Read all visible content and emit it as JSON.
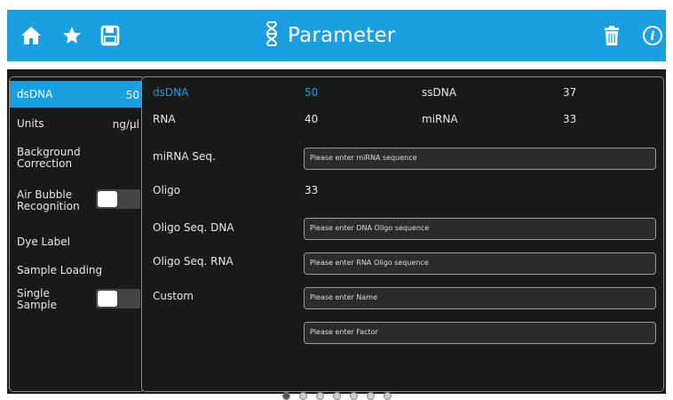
{
  "header": {
    "title": "Parameter",
    "icons": [
      "home-icon",
      "star-icon",
      "save-icon",
      "dna-icon",
      "trash-icon",
      "info-icon"
    ],
    "background_color": "#1aa0e0"
  },
  "sidebar": {
    "items": [
      {
        "label": "dsDNA",
        "value": "50",
        "selected": true
      },
      {
        "label": "Units",
        "value": "ng/µl"
      },
      {
        "label": "Background Correction"
      },
      {
        "label": "Air Bubble Recognition",
        "toggle": "off"
      },
      {
        "label": "Dye Label"
      },
      {
        "label": "Sample Loading"
      },
      {
        "label": "Single Sample",
        "toggle": "off"
      }
    ]
  },
  "main": {
    "rows": {
      "dsdna": {
        "label": "dsDNA",
        "value": "50"
      },
      "ssdna": {
        "label": "ssDNA",
        "value": "37"
      },
      "rna": {
        "label": "RNA",
        "value": "40"
      },
      "mirna": {
        "label": "miRNA",
        "value": "33"
      },
      "mirna_seq": {
        "label": "miRNA Seq.",
        "placeholder": "Please enter miRNA sequence"
      },
      "oligo": {
        "label": "Oligo",
        "value": "33"
      },
      "oligo_seq_dna": {
        "label": "Oligo Seq. DNA",
        "placeholder": "Please enter DNA Oligo sequence"
      },
      "oligo_seq_rna": {
        "label": "Oligo Seq. RNA",
        "placeholder": "Please enter RNA Oligo sequence"
      },
      "custom": {
        "label": "Custom",
        "name_placeholder": "Please enter Name",
        "factor_placeholder": "Please enter Factor"
      }
    }
  },
  "pager": {
    "pages": 7,
    "current": 1
  },
  "colors": {
    "accent": "#1aa0e0",
    "panel": "#191919",
    "field": "#2b2b2b"
  }
}
